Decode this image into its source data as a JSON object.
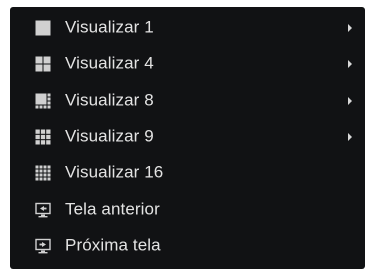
{
  "menu": {
    "items": [
      {
        "label": "Visualizar 1",
        "icon": "single-view-icon",
        "has_submenu": true
      },
      {
        "label": "Visualizar 4",
        "icon": "quad-view-icon",
        "has_submenu": true
      },
      {
        "label": "Visualizar 8",
        "icon": "eight-view-icon",
        "has_submenu": true
      },
      {
        "label": "Visualizar 9",
        "icon": "nine-view-icon",
        "has_submenu": true
      },
      {
        "label": "Visualizar 16",
        "icon": "sixteen-view-icon",
        "has_submenu": false
      },
      {
        "label": "Tela anterior",
        "icon": "previous-screen-icon",
        "has_submenu": false
      },
      {
        "label": "Próxima tela",
        "icon": "next-screen-icon",
        "has_submenu": false
      }
    ]
  },
  "colors": {
    "menu_background": "#111214",
    "text": "#e3e3e3",
    "icon": "#d0d0d0"
  }
}
